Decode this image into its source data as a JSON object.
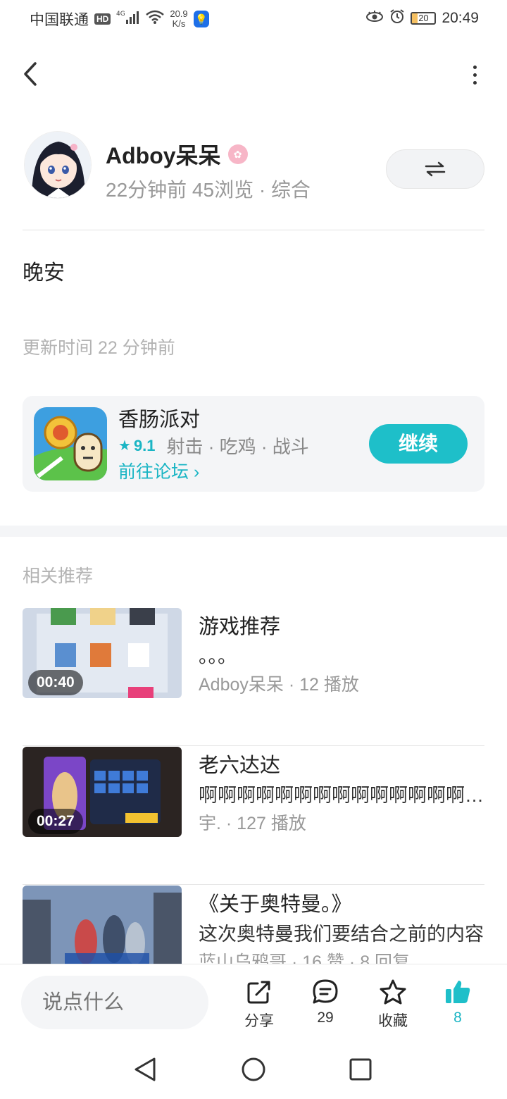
{
  "status_bar": {
    "carrier": "中国联通",
    "hd": "HD",
    "network": "4G",
    "speed_value": "20.9",
    "speed_unit": "K/s",
    "battery": "20",
    "time": "20:49"
  },
  "author": {
    "name": "Adboy呆呆",
    "meta": "22分钟前  45浏览 · 综合"
  },
  "post": {
    "text": "晚安",
    "update_time": "更新时间 22 分钟前"
  },
  "game_card": {
    "name": "香肠派对",
    "rating": "9.1",
    "tags": "射击 · 吃鸡 · 战斗",
    "forum_link": "前往论坛",
    "continue_label": "继续"
  },
  "related": {
    "title": "相关推荐",
    "items": [
      {
        "duration": "00:40",
        "title": "游戏推荐",
        "desc": "。。。",
        "meta": "Adboy呆呆 · 12 播放"
      },
      {
        "duration": "00:27",
        "title": "老六达达",
        "desc": "啊啊啊啊啊啊啊啊啊啊啊啊啊啊啊啊啊啊啊啊",
        "meta": "宇. · 127 播放"
      },
      {
        "duration": "",
        "title": "《关于奥特曼。》",
        "desc": "这次奥特曼我们要结合之前的内容",
        "meta": "蓝山乌鸦哥 · 16 赞 · 8 回复"
      }
    ]
  },
  "action_bar": {
    "input_placeholder": "说点什么",
    "share_label": "分享",
    "comment_count": "29",
    "favorite_label": "收藏",
    "like_count": "8"
  },
  "colors": {
    "accent": "#1ebfc9",
    "text_primary": "#222222",
    "text_secondary": "#999999",
    "card_bg": "#f4f5f7"
  }
}
